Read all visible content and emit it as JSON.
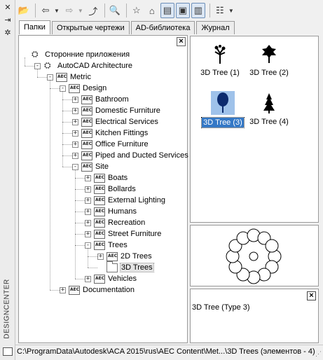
{
  "palette": {
    "title": "DESIGNCENTER",
    "strip_buttons": [
      {
        "icon": "close-icon",
        "glyph": "✕"
      },
      {
        "icon": "auto-hide-icon",
        "glyph": "⇥"
      },
      {
        "icon": "properties-icon",
        "glyph": "✲"
      }
    ]
  },
  "toolbar": {
    "buttons": [
      {
        "icon": "load-icon",
        "glyph": "📂"
      },
      {
        "icon": "back-icon",
        "glyph": "⇦"
      },
      {
        "icon": "forward-icon",
        "glyph": "⇨"
      },
      {
        "icon": "up-icon",
        "glyph": "⤴"
      },
      {
        "icon": "search-icon",
        "glyph": "🔍"
      },
      {
        "icon": "favorites-icon",
        "glyph": "☆"
      },
      {
        "icon": "home-icon",
        "glyph": "⌂"
      },
      {
        "icon": "tree-view-toggle-icon",
        "glyph": "▤"
      },
      {
        "icon": "preview-icon",
        "glyph": "▣"
      },
      {
        "icon": "description-icon",
        "glyph": "▥"
      },
      {
        "icon": "views-icon",
        "glyph": "☷"
      }
    ]
  },
  "tabs": [
    {
      "label": "Папки",
      "active": true
    },
    {
      "label": "Открытые чертежи",
      "active": false
    },
    {
      "label": "AD-библиотека",
      "active": false
    },
    {
      "label": "Журнал",
      "active": false
    }
  ],
  "tree": {
    "nodes": [
      {
        "label": "Сторонние приложения",
        "level": 0,
        "icon": "app",
        "exp": "none"
      },
      {
        "label": "AutoCAD Architecture",
        "level": 1,
        "icon": "app",
        "exp": "-"
      },
      {
        "label": "Metric",
        "level": 2,
        "icon": "aec",
        "exp": "-"
      },
      {
        "label": "Design",
        "level": 3,
        "icon": "aec",
        "exp": "-"
      },
      {
        "label": "Bathroom",
        "level": 4,
        "icon": "aec",
        "exp": "+"
      },
      {
        "label": "Domestic Furniture",
        "level": 4,
        "icon": "aec",
        "exp": "+"
      },
      {
        "label": "Electrical Services",
        "level": 4,
        "icon": "aec",
        "exp": "+"
      },
      {
        "label": "Kitchen Fittings",
        "level": 4,
        "icon": "aec",
        "exp": "+"
      },
      {
        "label": "Office Furniture",
        "level": 4,
        "icon": "aec",
        "exp": "+"
      },
      {
        "label": "Piped and Ducted Services",
        "level": 4,
        "icon": "aec",
        "exp": "+"
      },
      {
        "label": "Site",
        "level": 4,
        "icon": "aec",
        "exp": "-"
      },
      {
        "label": "Boats",
        "level": 5,
        "icon": "aec",
        "exp": "+"
      },
      {
        "label": "Bollards",
        "level": 5,
        "icon": "aec",
        "exp": "+"
      },
      {
        "label": "External Lighting",
        "level": 5,
        "icon": "aec",
        "exp": "+"
      },
      {
        "label": "Humans",
        "level": 5,
        "icon": "aec",
        "exp": "+"
      },
      {
        "label": "Recreation",
        "level": 5,
        "icon": "aec",
        "exp": "+"
      },
      {
        "label": "Street Furniture",
        "level": 5,
        "icon": "aec",
        "exp": "+"
      },
      {
        "label": "Trees",
        "level": 5,
        "icon": "aec",
        "exp": "-"
      },
      {
        "label": "2D Trees",
        "level": 6,
        "icon": "aec",
        "exp": "+"
      },
      {
        "label": "3D Trees",
        "level": 6,
        "icon": "folder",
        "exp": "none",
        "selected": true
      },
      {
        "label": "Vehicles",
        "level": 5,
        "icon": "aec",
        "exp": "+"
      },
      {
        "label": "Documentation",
        "level": 3,
        "icon": "aec",
        "exp": "+"
      }
    ]
  },
  "items": [
    {
      "label": "3D Tree (1)",
      "icon": "tree-1-icon",
      "selected": false
    },
    {
      "label": "3D Tree (2)",
      "icon": "tree-2-icon",
      "selected": false
    },
    {
      "label": "3D Tree (3)",
      "icon": "tree-3-icon",
      "selected": true
    },
    {
      "label": "3D Tree (4)",
      "icon": "tree-4-icon",
      "selected": false
    }
  ],
  "description": {
    "text": "3D Tree (Type 3)"
  },
  "status": {
    "path": "C:\\ProgramData\\Autodesk\\ACA 2015\\rus\\AEC Content\\Met...\\3D Trees (элементов - 4)"
  },
  "colors": {
    "selection": "#3478c6",
    "selection_thumb": "#9fc2ea"
  }
}
